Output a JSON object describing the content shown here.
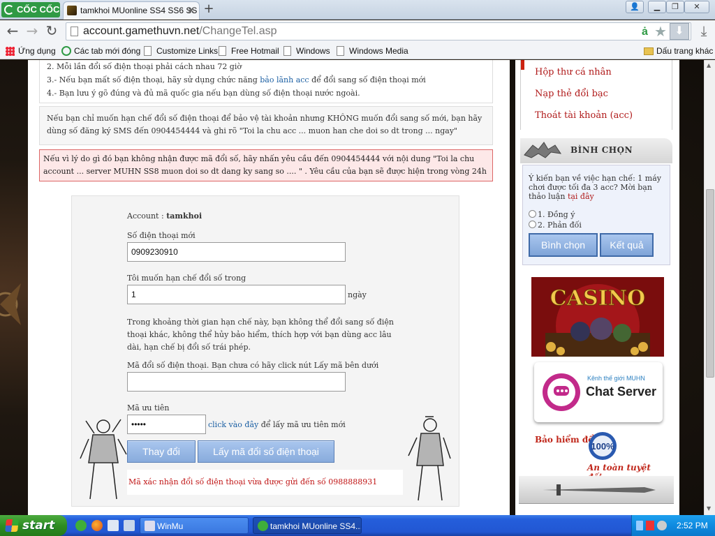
{
  "browser": {
    "logo_text": "CỐC CỐC",
    "tab_title": "tamkhoi MUonline SS4 SS6 SS",
    "url_host": "account.gamethuvn.net",
    "url_path": "/ChangeTel.asp",
    "omnibox_badge": "ȧ",
    "bookmarks": [
      {
        "label": "Ứng dụng",
        "icon": "apps-icon"
      },
      {
        "label": "Các tab mới đóng",
        "icon": "recent-tabs-icon"
      },
      {
        "label": "Customize Links",
        "icon": "page-icon"
      },
      {
        "label": "Free Hotmail",
        "icon": "page-icon"
      },
      {
        "label": "Windows",
        "icon": "page-icon"
      },
      {
        "label": "Windows Media",
        "icon": "page-icon"
      }
    ],
    "other_bookmarks": "Dấu trang khác"
  },
  "notes": {
    "line2": "2. Mỗi lần đổi số điện thoại phải cách nhau 72 giờ",
    "line3_pre": "3.- Nếu bạn mất số điện thoại, hãy sử dụng chức năng ",
    "line3_link": "bảo lãnh acc",
    "line3_post": " để đổi sang số điện thoại mới",
    "line4": "4.- Bạn lưu ý gõ đúng và đủ mã quốc gia nếu bạn dùng số điện thoại nước ngoài."
  },
  "info_text": "Nếu bạn chỉ muốn hạn chế đổi số điện thoại để bảo vệ tài khoản nhưng KHÔNG muốn đổi sang số mới, bạn hãy dùng số đăng ký SMS đến 0904454444 và ghi rõ \"Toi la chu acc ... muon han che doi so dt trong ... ngay\"",
  "alert_text": "Nếu vì lý do gì đó bạn không nhận được mã đổi số, hãy nhấn yêu cầu đến 0904454444 với nội dung \"Toi la chu account ... server MUHN SS8 muon doi so dt dang ky sang so .... \" . Yêu cầu của bạn sẽ được hiện trong vòng 24h",
  "form": {
    "account_label": "Account : ",
    "account_value": "tamkhoi",
    "new_phone_label": "Số điện thoại mới",
    "new_phone_value": "0909230910",
    "limit_label": "Tôi muốn hạn chế đổi số trong",
    "limit_value": "1",
    "limit_unit": "ngày",
    "limit_note": "Trong khoảng thời gian hạn chế này, bạn không thể đổi sang số điện thoại khác, không thể hủy bảo hiểm, thích hợp với bạn dùng acc lâu dài, hạn chế bị đổi số trái phép.",
    "code_label": "Mã đổi số điện thoại. Bạn chưa có hãy click nút Lấy mã bên dưới",
    "code_value": "",
    "priority_label": "Mã ưu tiên",
    "priority_value": "•••••",
    "priority_link": "click vào đây",
    "priority_link_suffix": " để lấy mã ưu tiên mới",
    "submit_button": "Thay đổi",
    "get_code_button": "Lấy mã đổi số điện thoại",
    "status_message": "Mã xác nhận đổi số điện thoại vừa được gửi đến số 0988888931"
  },
  "sidebar": {
    "links": [
      "Hộp thư cá nhân",
      "Nạp thẻ đổi bạc",
      "Thoát tài khoản (acc)"
    ],
    "vote_title": "BÌNH CHỌN",
    "vote_question": "Ý kiến bạn về việc hạn chế: 1 máy chơi được tối đa 3 acc? Mời bạn thảo luận ",
    "vote_link": "tại đây",
    "vote_options": [
      "1. Đồng ý",
      "2. Phản đối"
    ],
    "vote_button": "Bình chọn",
    "result_button": "Kết quả",
    "casino_text": "CASINO",
    "chat_tagline": "Kênh thế giới MUHN",
    "chat_title": "Chat Server",
    "insurance_title": "Bảo hiểm đổi",
    "insurance_badge": "100%",
    "insurance_slogan": "An toàn tuyệt đối"
  },
  "taskbar": {
    "start_label": "start",
    "tasks": [
      "WinMu",
      "tamkhoi MUonline SS4..."
    ],
    "clock": "2:52 PM"
  },
  "colors": {
    "accent_red": "#b01a1a",
    "link_blue": "#1b5fa3",
    "button_blue": "#88abdc"
  }
}
